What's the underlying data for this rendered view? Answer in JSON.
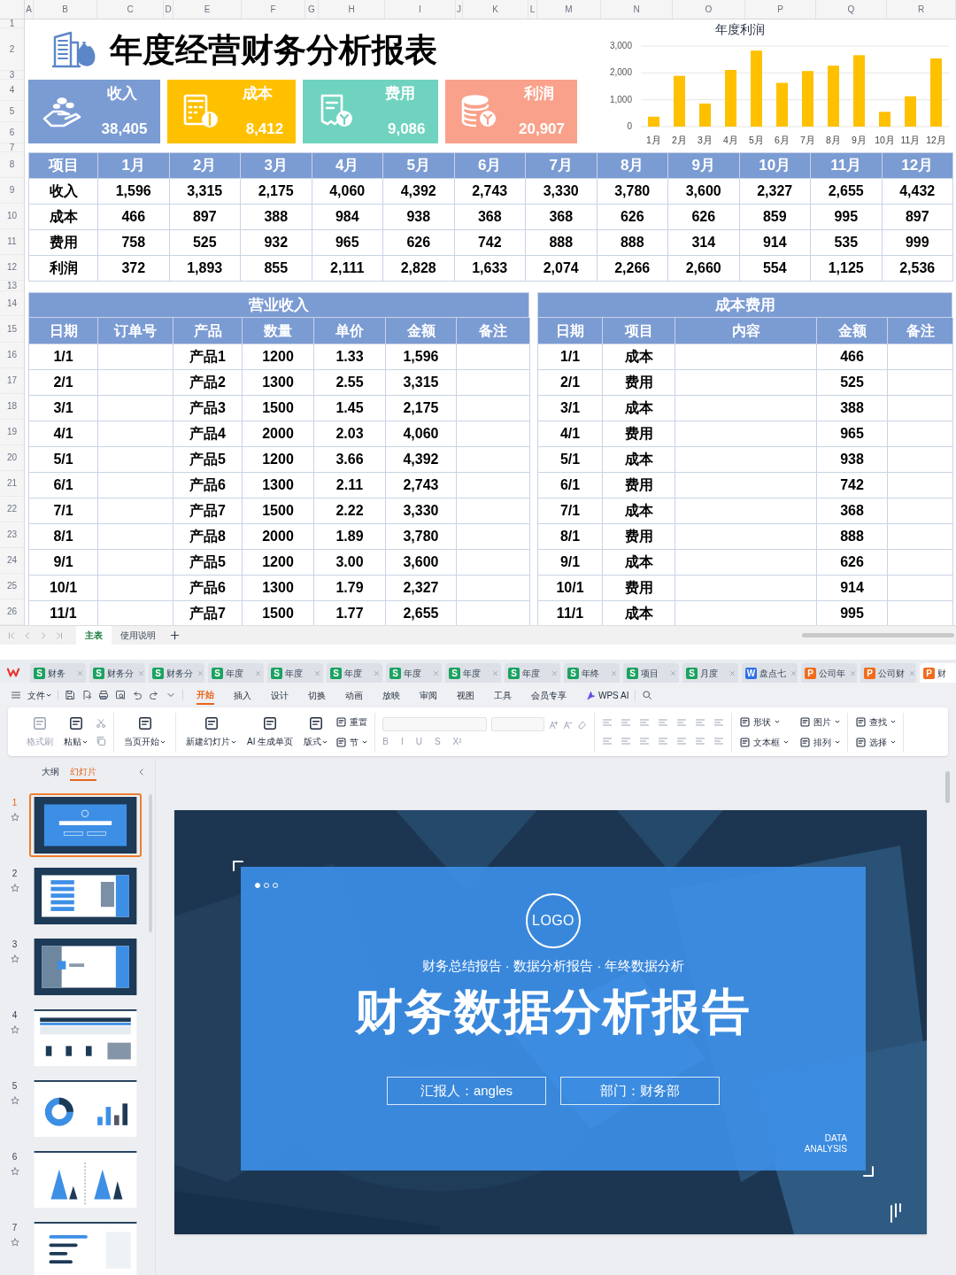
{
  "sheet": {
    "columns": [
      "A",
      "B",
      "C",
      "D",
      "E",
      "F",
      "G",
      "H",
      "I",
      "J",
      "K",
      "L",
      "M",
      "N",
      "O",
      "P",
      "Q",
      "R"
    ],
    "row_numbers": [
      "1",
      "2",
      "3",
      "4",
      "5",
      "6",
      "7",
      "8",
      "9",
      "10",
      "11",
      "12",
      "13",
      "14",
      "15",
      "16",
      "17",
      "18",
      "19",
      "20",
      "21",
      "22",
      "23",
      "24",
      "25",
      "26"
    ],
    "title": "年度经营财务分析报表",
    "kpis": [
      {
        "kind": "income",
        "label": "收入",
        "value": "38,405",
        "color": "#7b9bd3"
      },
      {
        "kind": "cost",
        "label": "成本",
        "value": "8,412",
        "color": "#ffc000"
      },
      {
        "kind": "expense",
        "label": "费用",
        "value": "9,086",
        "color": "#6fd3bf"
      },
      {
        "kind": "profit",
        "label": "利润",
        "value": "20,907",
        "color": "#f9a18b"
      }
    ],
    "chart": {
      "chart_data": {
        "type": "bar",
        "title": "年度利润",
        "categories": [
          "1月",
          "2月",
          "3月",
          "4月",
          "5月",
          "6月",
          "7月",
          "8月",
          "9月",
          "10月",
          "11月",
          "12月"
        ],
        "values": [
          370,
          1890,
          860,
          2110,
          2830,
          1630,
          2070,
          2270,
          2660,
          550,
          1130,
          2540
        ],
        "ylim": [
          0,
          3000
        ],
        "yticks": [
          {
            "value": 0,
            "label": "0"
          },
          {
            "value": 1000,
            "label": "1,000"
          },
          {
            "value": 2000,
            "label": "2,000"
          },
          {
            "value": 3000,
            "label": "3,000"
          }
        ]
      }
    },
    "summary": {
      "columns": [
        "项目",
        "1月",
        "2月",
        "3月",
        "4月",
        "5月",
        "6月",
        "7月",
        "8月",
        "9月",
        "10月",
        "11月",
        "12月"
      ],
      "rows": [
        {
          "label": "收入",
          "values": [
            "1,596",
            "3,315",
            "2,175",
            "4,060",
            "4,392",
            "2,743",
            "3,330",
            "3,780",
            "3,600",
            "2,327",
            "2,655",
            "4,432"
          ]
        },
        {
          "label": "成本",
          "values": [
            "466",
            "897",
            "388",
            "984",
            "938",
            "368",
            "368",
            "626",
            "626",
            "859",
            "995",
            "897"
          ]
        },
        {
          "label": "费用",
          "values": [
            "758",
            "525",
            "932",
            "965",
            "626",
            "742",
            "888",
            "888",
            "314",
            "914",
            "535",
            "999"
          ]
        },
        {
          "label": "利润",
          "values": [
            "372",
            "1,893",
            "855",
            "2,111",
            "2,828",
            "1,633",
            "2,074",
            "2,266",
            "2,660",
            "554",
            "1,125",
            "2,536"
          ]
        }
      ]
    },
    "income": {
      "title": "营业收入",
      "columns": [
        "日期",
        "订单号",
        "产品",
        "数量",
        "单价",
        "金额",
        "备注"
      ],
      "rows": [
        {
          "date": "1/1",
          "product": "产品1",
          "qty": "1200",
          "price": "1.33",
          "amount": "1,596"
        },
        {
          "date": "2/1",
          "product": "产品2",
          "qty": "1300",
          "price": "2.55",
          "amount": "3,315"
        },
        {
          "date": "3/1",
          "product": "产品3",
          "qty": "1500",
          "price": "1.45",
          "amount": "2,175"
        },
        {
          "date": "4/1",
          "product": "产品4",
          "qty": "2000",
          "price": "2.03",
          "amount": "4,060"
        },
        {
          "date": "5/1",
          "product": "产品5",
          "qty": "1200",
          "price": "3.66",
          "amount": "4,392"
        },
        {
          "date": "6/1",
          "product": "产品6",
          "qty": "1300",
          "price": "2.11",
          "amount": "2,743"
        },
        {
          "date": "7/1",
          "product": "产品7",
          "qty": "1500",
          "price": "2.22",
          "amount": "3,330"
        },
        {
          "date": "8/1",
          "product": "产品8",
          "qty": "2000",
          "price": "1.89",
          "amount": "3,780"
        },
        {
          "date": "9/1",
          "product": "产品5",
          "qty": "1200",
          "price": "3.00",
          "amount": "3,600"
        },
        {
          "date": "10/1",
          "product": "产品6",
          "qty": "1300",
          "price": "1.79",
          "amount": "2,327"
        },
        {
          "date": "11/1",
          "product": "产品7",
          "qty": "1500",
          "price": "1.77",
          "amount": "2,655"
        }
      ]
    },
    "costs": {
      "title": "成本费用",
      "columns": [
        "日期",
        "项目",
        "内容",
        "金额",
        "备注"
      ],
      "rows": [
        {
          "date": "1/1",
          "item": "成本",
          "amount": "466"
        },
        {
          "date": "2/1",
          "item": "费用",
          "amount": "525"
        },
        {
          "date": "3/1",
          "item": "成本",
          "amount": "388"
        },
        {
          "date": "4/1",
          "item": "费用",
          "amount": "965"
        },
        {
          "date": "5/1",
          "item": "成本",
          "amount": "938"
        },
        {
          "date": "6/1",
          "item": "费用",
          "amount": "742"
        },
        {
          "date": "7/1",
          "item": "成本",
          "amount": "368"
        },
        {
          "date": "8/1",
          "item": "费用",
          "amount": "888"
        },
        {
          "date": "9/1",
          "item": "成本",
          "amount": "626"
        },
        {
          "date": "10/1",
          "item": "费用",
          "amount": "914"
        },
        {
          "date": "11/1",
          "item": "成本",
          "amount": "995"
        }
      ]
    },
    "sheet_tabs": [
      {
        "label": "主表",
        "selected": true
      },
      {
        "label": "使用说明",
        "selected": false
      }
    ]
  },
  "doc_tabs": [
    {
      "kind": "sheet",
      "badge": "S",
      "label": "财务",
      "selected": false
    },
    {
      "kind": "sheet",
      "badge": "S",
      "label": "财务分",
      "selected": false
    },
    {
      "kind": "sheet",
      "badge": "S",
      "label": "财务分",
      "selected": false
    },
    {
      "kind": "sheet",
      "badge": "S",
      "label": "年度",
      "selected": false
    },
    {
      "kind": "sheet",
      "badge": "S",
      "label": "年度",
      "selected": false
    },
    {
      "kind": "sheet",
      "badge": "S",
      "label": "年度",
      "selected": false
    },
    {
      "kind": "sheet",
      "badge": "S",
      "label": "年度",
      "selected": false
    },
    {
      "kind": "sheet",
      "badge": "S",
      "label": "年度",
      "selected": false
    },
    {
      "kind": "sheet",
      "badge": "S",
      "label": "年度",
      "selected": false
    },
    {
      "kind": "sheet",
      "badge": "S",
      "label": "年终",
      "selected": false
    },
    {
      "kind": "sheet",
      "badge": "S",
      "label": "项目",
      "selected": false
    },
    {
      "kind": "sheet",
      "badge": "S",
      "label": "月度",
      "selected": false
    },
    {
      "kind": "doc",
      "badge": "W",
      "label": "盘点七",
      "selected": false
    },
    {
      "kind": "slides",
      "badge": "P",
      "label": "公司年",
      "selected": false
    },
    {
      "kind": "slides",
      "badge": "P",
      "label": "公司财",
      "selected": false
    },
    {
      "kind": "slides",
      "badge": "P",
      "label": "财",
      "selected": true
    }
  ],
  "menu": {
    "file": "文件",
    "tabs": [
      {
        "label": "开始",
        "selected": true
      },
      {
        "label": "插入",
        "selected": false
      },
      {
        "label": "设计",
        "selected": false
      },
      {
        "label": "切换",
        "selected": false
      },
      {
        "label": "动画",
        "selected": false
      },
      {
        "label": "放映",
        "selected": false
      },
      {
        "label": "审阅",
        "selected": false
      },
      {
        "label": "视图",
        "selected": false
      },
      {
        "label": "工具",
        "selected": false
      },
      {
        "label": "会员专享",
        "selected": false
      },
      {
        "label": "WPS AI",
        "selected": false
      }
    ]
  },
  "ribbon": [
    {
      "kind": "clipboard",
      "items": [
        {
          "label": "格式刷",
          "kind": "large",
          "disabled": true,
          "dropdown": false
        },
        {
          "label": "粘贴",
          "kind": "large",
          "disabled": false,
          "dropdown": true
        }
      ]
    },
    {
      "kind": "tools",
      "items": [
        {
          "label": "当页开始",
          "kind": "large",
          "disabled": false,
          "dropdown": true
        }
      ]
    },
    {
      "kind": "tools",
      "items": [
        {
          "label": "新建幻灯片",
          "kind": "large",
          "disabled": false,
          "dropdown": true
        },
        {
          "label": "AI 生成单页",
          "kind": "large",
          "disabled": false,
          "dropdown": false
        },
        {
          "label": "版式",
          "kind": "large",
          "disabled": false,
          "dropdown": true
        },
        {
          "label": "重置",
          "kind": "small",
          "disabled": false,
          "dropdown": false
        },
        {
          "label": "节",
          "kind": "small",
          "disabled": false,
          "dropdown": true
        }
      ]
    },
    {
      "kind": "font",
      "disabled": true,
      "format_buttons": [
        "B",
        "I",
        "U",
        "S",
        "X²"
      ]
    },
    {
      "kind": "paragraph",
      "disabled": true
    },
    {
      "kind": "tools",
      "items": [
        {
          "label": "形状",
          "kind": "small",
          "disabled": false,
          "dropdown": true
        },
        {
          "label": "文本框",
          "kind": "small",
          "disabled": false,
          "dropdown": true
        },
        {
          "label": "图片",
          "kind": "small",
          "disabled": false,
          "dropdown": true
        },
        {
          "label": "排列",
          "kind": "small",
          "disabled": false,
          "dropdown": true
        }
      ]
    },
    {
      "kind": "tools",
      "items": [
        {
          "label": "查找",
          "kind": "small",
          "disabled": false,
          "dropdown": true
        },
        {
          "label": "选择",
          "kind": "small",
          "disabled": false,
          "dropdown": true
        }
      ]
    }
  ],
  "panel_tabs": [
    {
      "label": "大纲",
      "selected": false
    },
    {
      "label": "幻灯片",
      "selected": true
    }
  ],
  "slides": [
    {
      "number": "1",
      "kind": "title",
      "selected": true
    },
    {
      "number": "2",
      "kind": "agenda",
      "selected": false
    },
    {
      "number": "3",
      "kind": "section",
      "selected": false
    },
    {
      "number": "4",
      "kind": "table",
      "selected": false
    },
    {
      "number": "5",
      "kind": "donut",
      "selected": false
    },
    {
      "number": "6",
      "kind": "triangles",
      "selected": false
    },
    {
      "number": "7",
      "kind": "bars",
      "selected": false
    }
  ],
  "slide": {
    "dots": [
      {
        "selected": true
      },
      {
        "selected": false
      },
      {
        "selected": false
      }
    ],
    "logo": "LOGO",
    "subtitle": "财务总结报告 · 数据分析报告 · 年终数据分析",
    "title": "财务数据分析报告",
    "fields": [
      "汇报人：angles",
      "部门：财务部"
    ],
    "tag_lines": [
      "DATA",
      "ANALYSIS"
    ]
  }
}
